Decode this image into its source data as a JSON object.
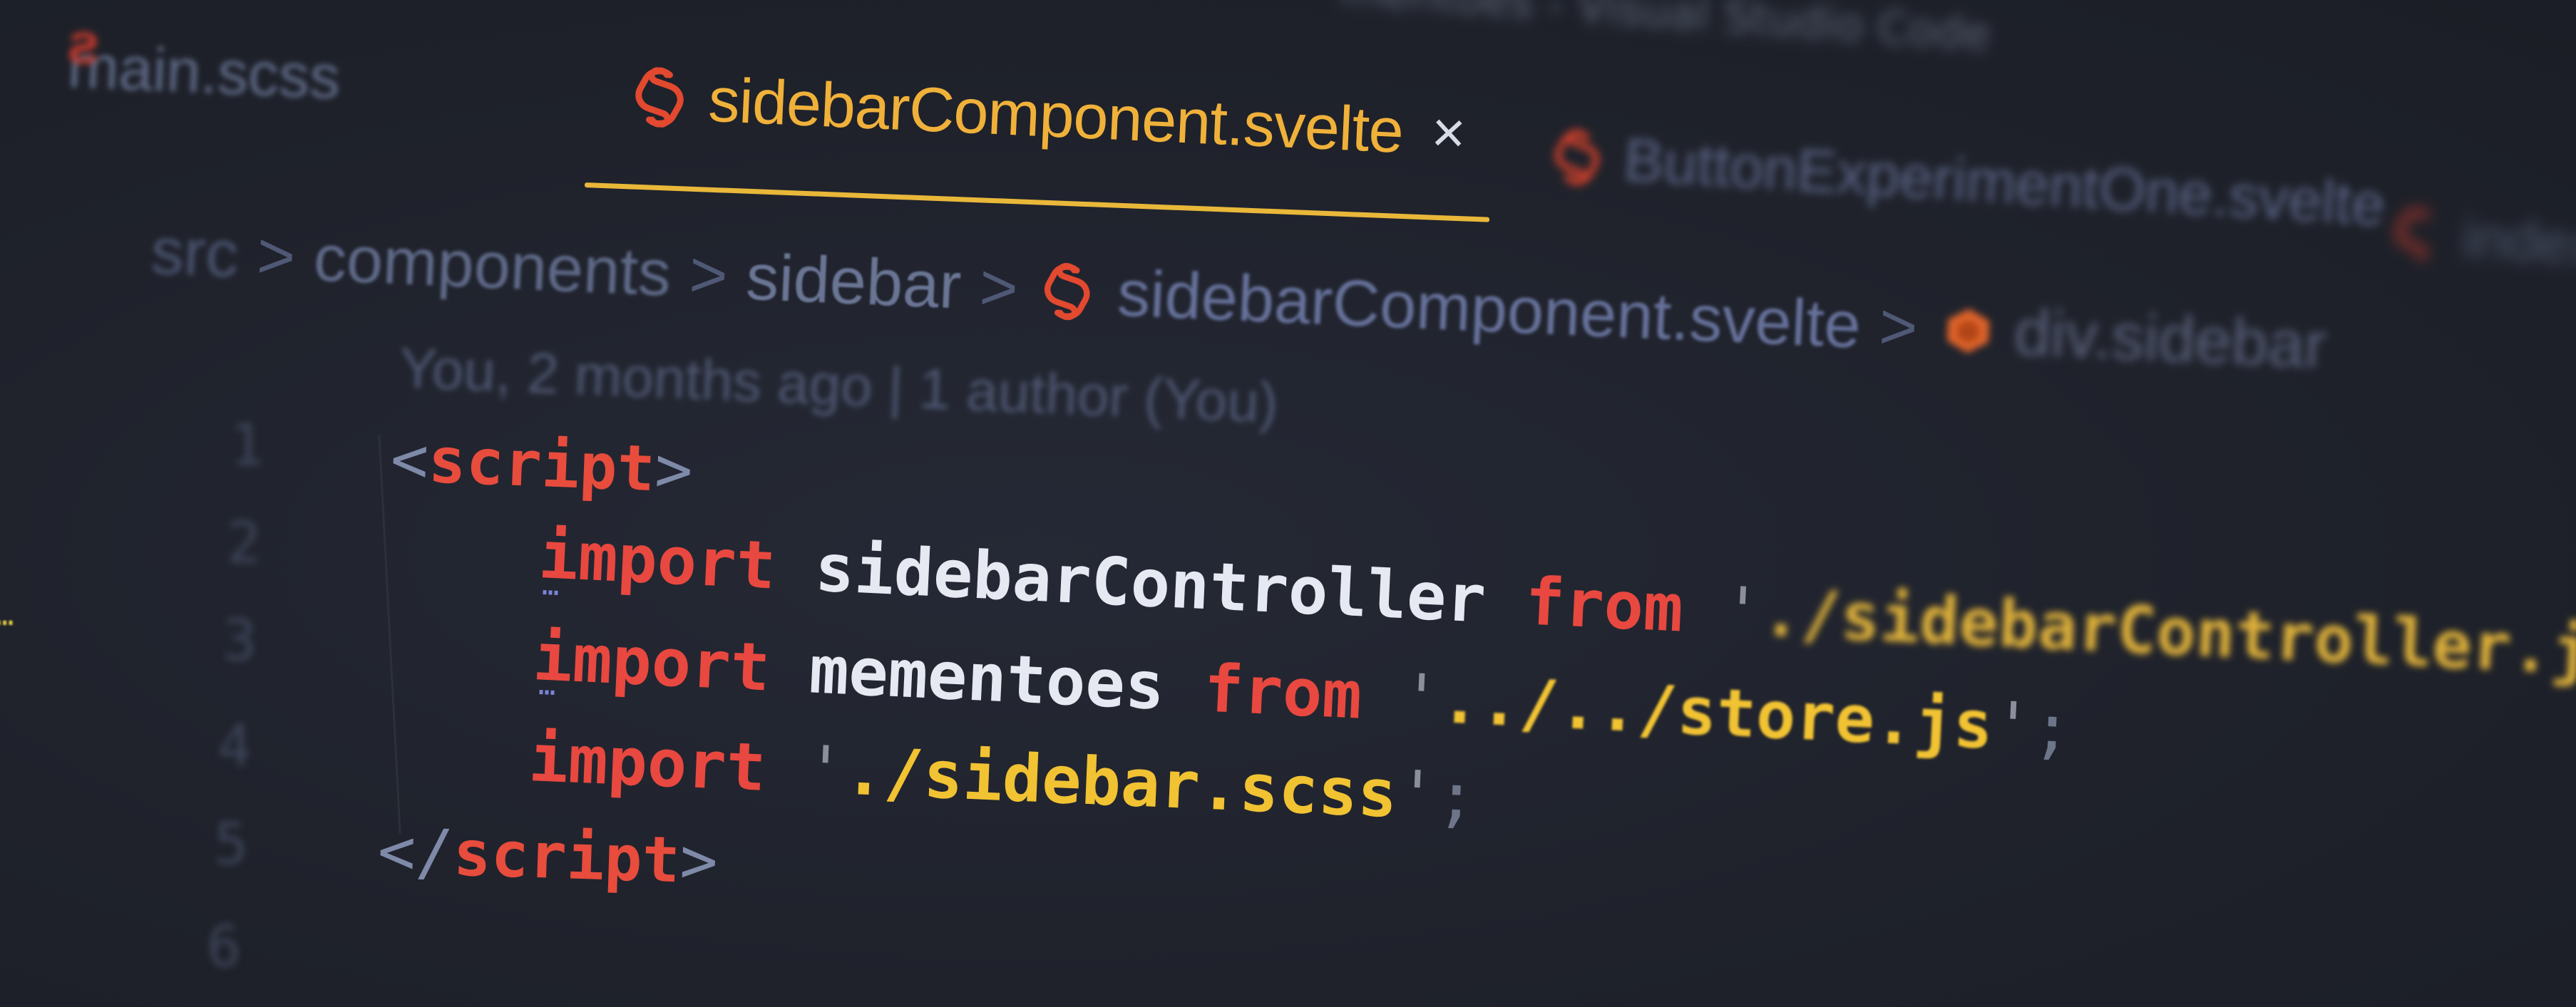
{
  "colors": {
    "background": "#20232c",
    "active_tab_accent": "#e9b83a",
    "svelte_icon": "#e2492f",
    "keyword": "#e8483f",
    "string": "#f1c232",
    "identifier": "#e6e9f2",
    "muted": "#56607c"
  },
  "window": {
    "title": "mentoes - Visual Studio Code"
  },
  "tabs": [
    {
      "label": "main.scss",
      "icon": "scss-icon",
      "active": false
    },
    {
      "label": "sidebarComponent.svelte",
      "icon": "svelte-icon",
      "active": true,
      "close_glyph": "×"
    },
    {
      "label": "ButtonExperimentOne.svelte",
      "icon": "svelte-icon",
      "active": false
    },
    {
      "label": "index",
      "icon": "svelte-icon",
      "active": false
    }
  ],
  "breadcrumb": {
    "items": [
      "src",
      "components",
      "sidebar",
      "sidebarComponent.svelte",
      "div.sidebar"
    ],
    "separator": ">"
  },
  "editor": {
    "blame": "You, 2 months ago | 1 author (You)",
    "line_numbers": [
      "1",
      "2",
      "3",
      "4",
      "5",
      "6"
    ],
    "gutter_marker": "…",
    "lines": {
      "l1": {
        "open": "<",
        "tag": "script",
        "close": ">"
      },
      "l2": {
        "kw": "import",
        "ident": "sidebarController",
        "from": "from",
        "q1": "'",
        "path": "./sidebarController.js",
        "q2": "'",
        "semi": ";"
      },
      "l3": {
        "kw": "import",
        "ident": "mementoes",
        "from": "from",
        "q1": "'",
        "path": "../../store.js",
        "q2": "'",
        "semi": ";"
      },
      "l4": {
        "kw": "import",
        "q1": "'",
        "path": "./sidebar.scss",
        "q2": "'",
        "semi": ";"
      },
      "l5": {
        "open": "</",
        "tag": "script",
        "close": ">"
      }
    }
  }
}
